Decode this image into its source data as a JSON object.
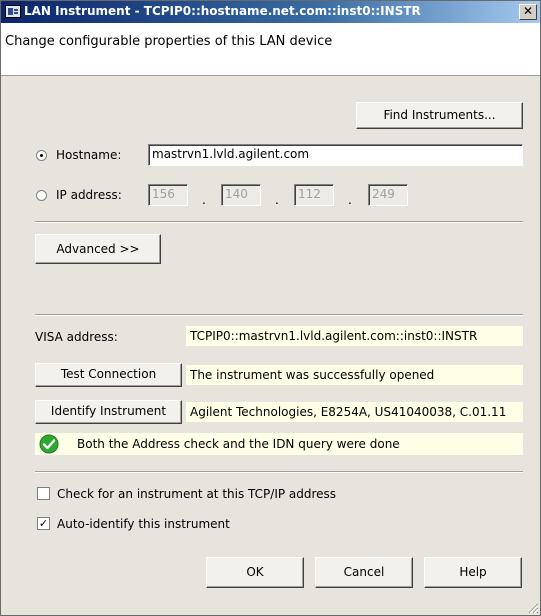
{
  "window": {
    "title": "LAN Instrument - TCPIP0::hostname.net.com::inst0::INSTR",
    "close_glyph": "✕"
  },
  "header": {
    "text": "Change configurable properties of this LAN device"
  },
  "find_button": {
    "label": "Find Instruments..."
  },
  "hostname": {
    "label": "Hostname:",
    "selected": true,
    "value": "mastrvn1.lvld.agilent.com"
  },
  "ip": {
    "label": "IP address:",
    "selected": false,
    "octets": [
      "156",
      "140",
      "112",
      "249"
    ],
    "separator": "."
  },
  "advanced_button": {
    "label": "Advanced >>"
  },
  "visa": {
    "label": "VISA address:",
    "value": "TCPIP0::mastrvn1.lvld.agilent.com::inst0::INSTR"
  },
  "test_connection": {
    "label": "Test Connection",
    "result": "The instrument was successfully opened"
  },
  "identify": {
    "label": "Identify Instrument",
    "result": "Agilent Technologies, E8254A, US41040038, C.01.11"
  },
  "status": {
    "icon": "check-circle-icon",
    "text": "Both the Address check and the IDN query were done",
    "color": "#2fa82f"
  },
  "options": {
    "check_tcpip": {
      "label": "Check for an instrument at this TCP/IP address",
      "checked": false
    },
    "auto_identify": {
      "label": "Auto-identify this instrument",
      "checked": true
    }
  },
  "buttons": {
    "ok": "OK",
    "cancel": "Cancel",
    "help": "Help"
  }
}
